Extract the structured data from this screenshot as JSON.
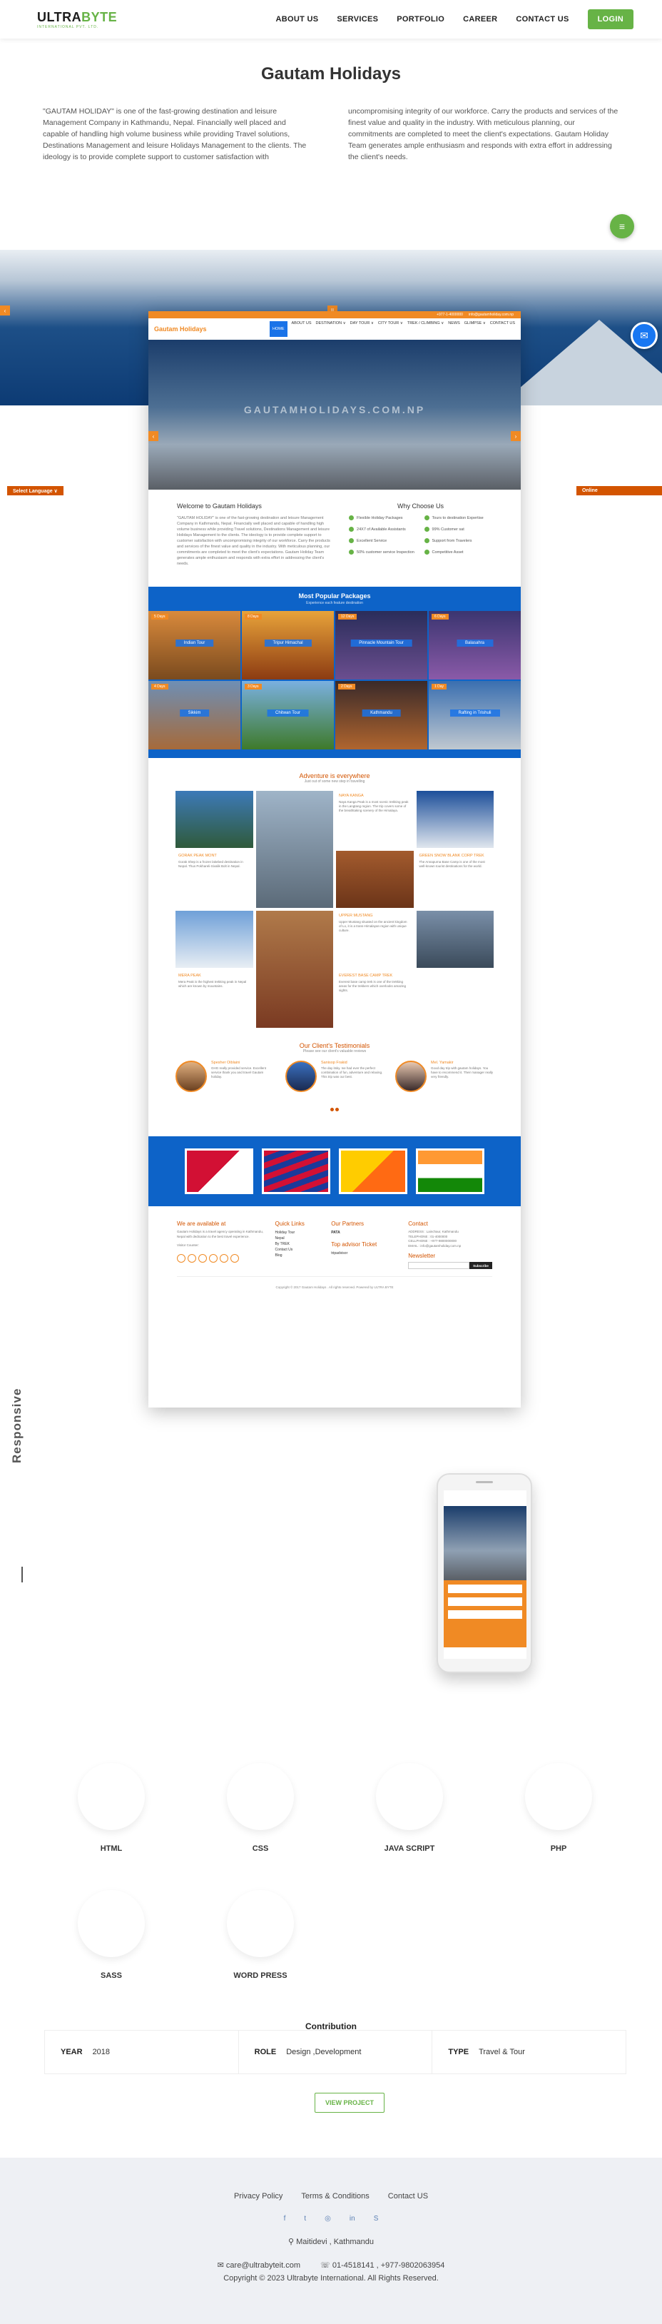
{
  "header": {
    "logo_part1": "ULTRA",
    "logo_part2": "BYTE",
    "logo_tagline": "INTERNATIONAL PVT. LTD.",
    "nav": [
      "ABOUT US",
      "SERVICES",
      "PORTFOLIO",
      "CAREER",
      "CONTACT US"
    ],
    "login_label": "LOGIN"
  },
  "project": {
    "title": "Gautam Holidays",
    "intro_left": "\"GAUTAM HOLIDAY\" is one of the fast-growing destination and leisure Management Company in Kathmandu, Nepal. Financially well placed and capable of handling high volume business while providing Travel solutions, Destinations Management and leisure Holidays Management to the clients. The ideology is to provide complete support to customer satisfaction with",
    "intro_right": "uncompromising integrity of our workforce. Carry the products and services of the finest value and quality in the industry. With meticulous planning, our commitments are completed to meet the client's expectations. Gautam Holiday Team generates ample enthusiasm and responds with extra effort in addressing the client's needs."
  },
  "side_tabs": {
    "left": "Select Language ∨",
    "right": "Online"
  },
  "mock": {
    "topbar": [
      "+977-1-4000000",
      "info@gautamholiday.com.np"
    ],
    "logo": "Gautam Holidays",
    "menu": [
      "HOME",
      "ABOUT US",
      "DESTINATION ∨",
      "DAY TOUR ∨",
      "CITY TOUR ∨",
      "TREK / CLIMBING ∨",
      "NEWS",
      "GLIMPSE ∨",
      "CONTACT US"
    ],
    "watermark": "GAUTAMHOLIDAYS.COM.NP",
    "welcome_title": "Welcome to Gautam Holidays",
    "welcome_text": "\"GAUTAM HOLIDAY\" is one of the fast-growing destination and leisure Management Company in Kathmandu, Nepal. Financially well placed and capable of handling high volume business while providing Travel solutions, Destinations Management and leisure Holidays Management to the clients. The ideology is to provide complete support to customer satisfaction with uncompromising integrity of our workforce. Carry the products and services of the finest value and quality in the industry. With meticulous planning, our commitments are completed to meet the client's expectations. Gautam Holiday Team generates ample enthusiasm and responds with extra effort in addressing the client's needs.",
    "why_title": "Why Choose Us",
    "why_items": [
      "Flexible Holiday Packages",
      "Tours to destination Expertise",
      "24X7 of Available Assistants",
      "99% Customer sat",
      "Excellent Service",
      "Support from Travelers",
      "50% customer service Inspection",
      "Competitive Asset"
    ],
    "packages_title": "Most Popular Packages",
    "packages_subtitle": "Experience each feature destination",
    "packages": [
      {
        "name": "Indian Tour",
        "tag": "5 Days"
      },
      {
        "name": "Tripur Himachal",
        "tag": "8 Days"
      },
      {
        "name": "Pinnacle Mountain Tour",
        "tag": "12 Days"
      },
      {
        "name": "Balasahra",
        "tag": "6 Days"
      },
      {
        "name": "Sikkim",
        "tag": "4 Days"
      },
      {
        "name": "Chitwan Tour",
        "tag": "3 Days"
      },
      {
        "name": "Kathmandu",
        "tag": "2 Days"
      },
      {
        "name": "Rafting in Trishuli",
        "tag": "1 Day"
      }
    ],
    "adventure_title": "Adventure is everywhere",
    "adventure_subtitle": "Just out of some new step in travelling",
    "adventure_items": [
      {
        "title": "NAYA KANGA",
        "text": "Naya Kanga Peak is a most scenic trekking peak in the Langtang region. The trip covers some of the breathtaking scenery of the Himalaya."
      },
      {
        "title": "GORAK PEAK MONT",
        "text": "Gorak Shep is a frozen lakebed destination in Nepal. Thus Pokhareli-Sivalik Bolt in Nepal."
      },
      {
        "title": "GREEN SNOW BLANK CORP TREK",
        "text": "The Annapurna Base Camp is one of the most well-known tourist destinations for the world."
      },
      {
        "title": "MERA PEAK",
        "text": "Mera Peak is the highest trekking peak in Nepal which are known by mountains."
      },
      {
        "title": "UPPER MUSTANG",
        "text": "Upper Mustang situated on the ancient kingdom of Lo, it is a trans-Himalayan region with unique culture."
      },
      {
        "title": "EVEREST BASE CAMP TREK",
        "text": "Everest base camp trek is one of the trekking areas for the trekkers which overlooks amazing sights."
      }
    ],
    "testimonial_title": "Our Client's Testimonials",
    "testimonial_subtitle": "Please see our client's valuable reviews",
    "testimonials": [
      {
        "name": "Spesher Oiblaini",
        "text": "GHG really provided service. Excellent service thank you and travel Gautam holiday."
      },
      {
        "name": "Sanisop Frakid",
        "text": "The day itsky. Ive had ever the perfect combination of fun, adventure and relaxing. This trip was our best."
      },
      {
        "name": "Mel. Yamakir",
        "text": "Good day trip with gautam holidays. You have to recommend it. Their manager really very friendly."
      }
    ],
    "footer_available_title": "We are available at",
    "footer_available_text": "Gautam Holidays is a travel agency operating in Kathmandu, Nepal with dedication to the best travel experience.",
    "footer_visitors": "Visitor Counter:",
    "footer_quick_title": "Quick Links",
    "footer_quick": [
      "Holiday Tour",
      "Nepal",
      "By TREK",
      "Contact Us",
      "Blog"
    ],
    "footer_partners_title": "Our Partners",
    "footer_partner_pata": "PATA",
    "footer_trip_title": "Top advisor Ticket",
    "footer_tripadvisor": "tripadvisor",
    "footer_contact_title": "Contact",
    "footer_contact": [
      "ADDRESS : Lainchaur, Kathmandu",
      "TELEPHONE : 01-4000000",
      "CELLPHONE : +977-9800000000",
      "EMAIL : info@gautamholiday.com.np"
    ],
    "footer_newsletter_title": "Newsletter",
    "footer_subscribe": "Subscribe",
    "copyright": "Copyright © 2017 Gautam Holidays . All rights reserved. Powered by ULTRA BYTE"
  },
  "responsive_label": "Responsive",
  "skills": [
    "HTML",
    "CSS",
    "JAVA SCRIPT",
    "PHP",
    "SASS",
    "WORD PRESS"
  ],
  "contribution": {
    "title": "Contribution",
    "year_label": "YEAR",
    "year_value": "2018",
    "role_label": "ROLE",
    "role_value": "Design ,Development",
    "type_label": "TYPE",
    "type_value": "Travel & Tour",
    "view_button": "VIEW PROJECT"
  },
  "footer": {
    "links": [
      "Privacy Policy",
      "Terms & Conditions",
      "Contact US"
    ],
    "social": [
      "facebook-icon",
      "twitter-icon",
      "instagram-icon",
      "linkedin-icon",
      "skype-icon"
    ],
    "address": "Maitidevi , Kathmandu",
    "email": "care@ultrabyteit.com",
    "phone": "01-4518141 , +977-9802063954",
    "copyright": "Copyright © 2023 Ultrabyte International. All Rights Reserved."
  },
  "colors": {
    "brand_green": "#67b346",
    "mock_orange": "#f08a24",
    "mock_blue": "#0d63c8"
  }
}
